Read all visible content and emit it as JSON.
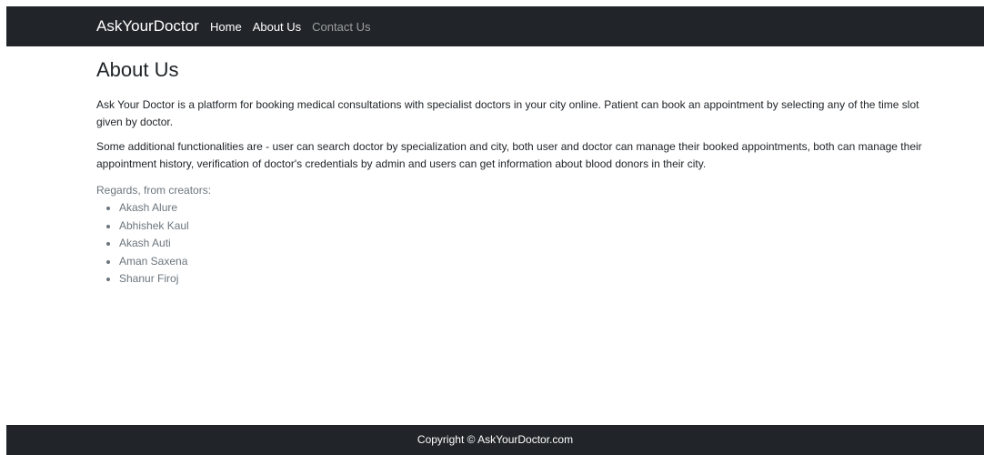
{
  "navbar": {
    "brand": "AskYourDoctor",
    "links": [
      {
        "label": "Home"
      },
      {
        "label": "About Us"
      },
      {
        "label": "Contact Us"
      }
    ]
  },
  "main": {
    "title": "About Us",
    "paragraphs": [
      "Ask Your Doctor is a platform for booking medical consultations with specialist doctors in your city online. Patient can book an appointment by selecting any of the time slot given by doctor.",
      "Some additional functionalities are - user can search doctor by specialization and city, both user and doctor can manage their booked appointments, both can manage their appointment history, verification of doctor's credentials by admin and users can get information about blood donors in their city."
    ],
    "regards": "Regards, from creators:",
    "creators": [
      "Akash Alure",
      "Abhishek Kaul",
      "Akash Auti",
      "Aman Saxena",
      "Shanur Firoj"
    ]
  },
  "footer": {
    "copyright": "Copyright © AskYourDoctor.com"
  },
  "colors": {
    "navbar_bg": "#212529",
    "muted_text": "#6c757d"
  }
}
